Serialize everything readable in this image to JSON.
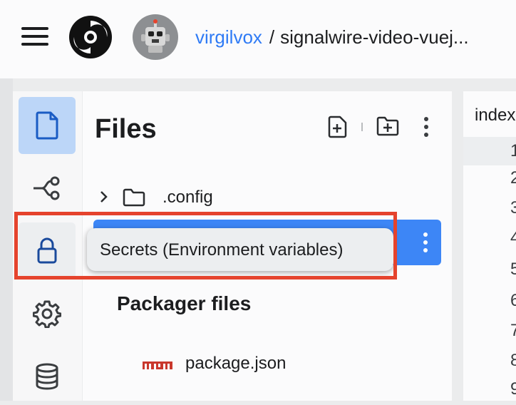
{
  "header": {
    "menu_icon": "hamburger-icon",
    "logo": "replit-logo",
    "username": "virgilvox",
    "separator": "/",
    "repo_name": "signalwire-video-vuej..."
  },
  "rail": {
    "items": [
      {
        "name": "files",
        "icon": "file-icon",
        "active": true
      },
      {
        "name": "version-control",
        "icon": "branch-icon"
      },
      {
        "name": "secrets",
        "icon": "lock-icon"
      },
      {
        "name": "settings",
        "icon": "gear-icon"
      },
      {
        "name": "database",
        "icon": "database-icon"
      }
    ]
  },
  "files_panel": {
    "title": "Files",
    "toolbar": [
      "new-file-icon",
      "new-folder-icon",
      "kebab-icon"
    ],
    "tree": [
      {
        "label": ".config",
        "icon": "folder-icon",
        "expanded": false
      }
    ],
    "packager_section": "Packager files",
    "packager_files": [
      {
        "label": "package.json",
        "icon": "npm-icon"
      }
    ]
  },
  "tooltip": {
    "text": "Secrets (Environment variables)"
  },
  "editor": {
    "tab_label": "index",
    "line_numbers": [
      "1",
      "2",
      "3",
      "4",
      "5",
      "6",
      "7",
      "8",
      "9"
    ]
  },
  "colors": {
    "accent": "#2f7bf5",
    "selected_row": "#3d86f6",
    "rail_active": "#bcd6f8",
    "highlight_box": "#e5432d"
  }
}
